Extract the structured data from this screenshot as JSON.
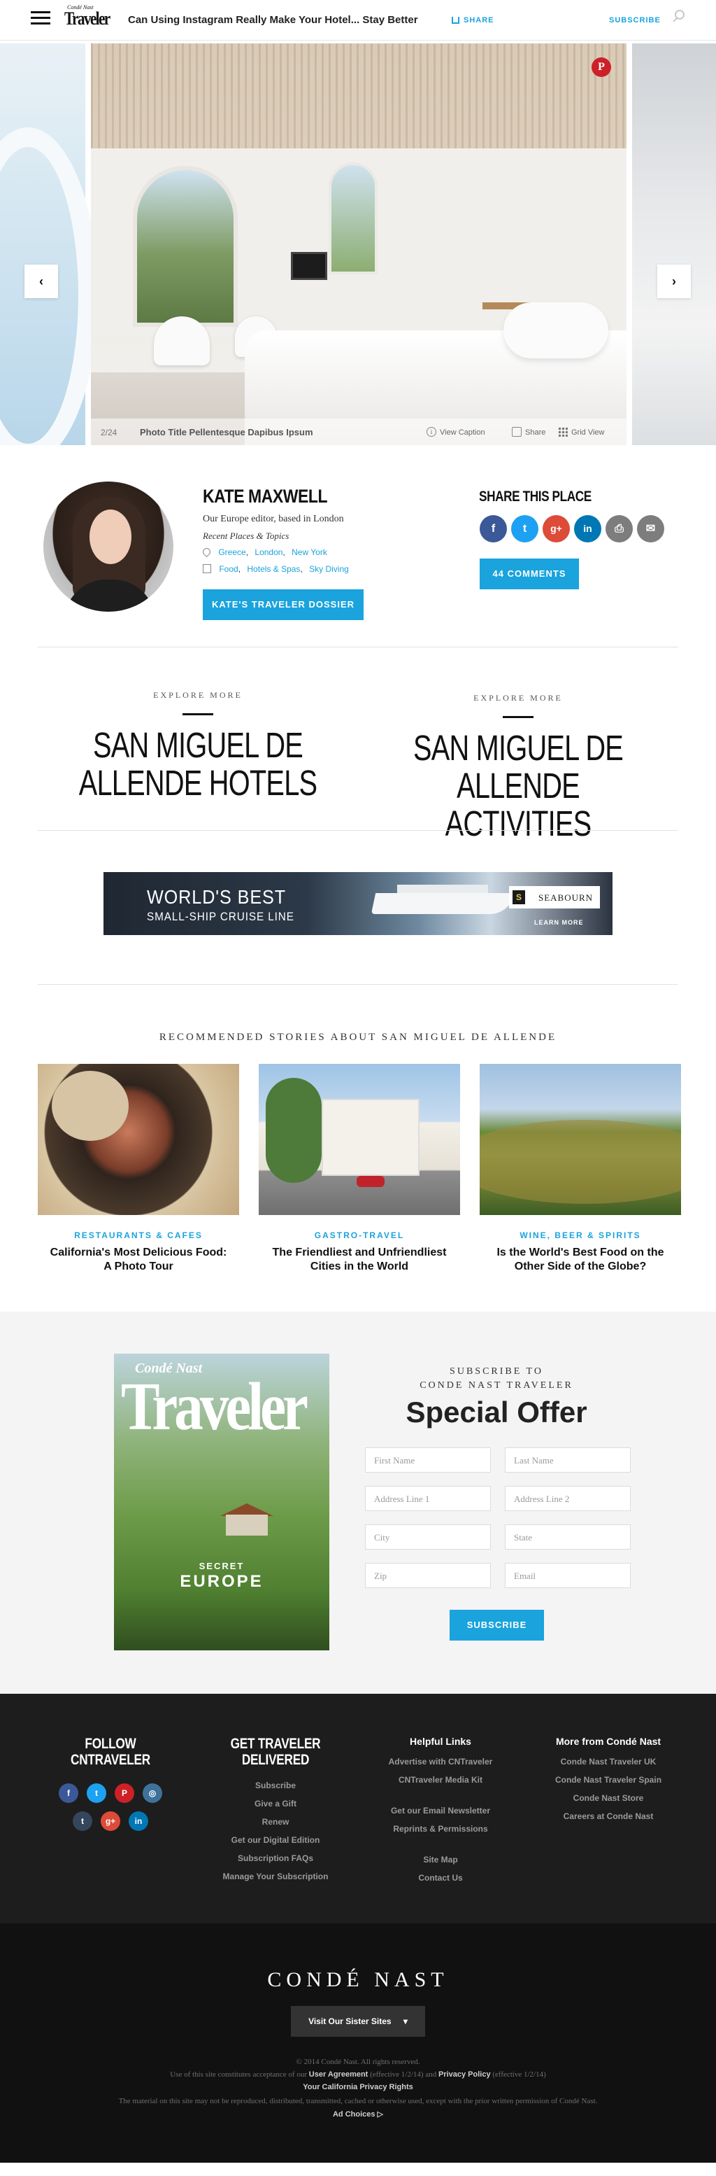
{
  "header": {
    "brand_small": "Condé Nast",
    "brand_big": "Traveler",
    "headline": "Can Using Instagram Really Make Your Hotel... Stay Better",
    "share_label": "SHARE",
    "subscribe_label": "SUBSCRIBE",
    "search_icon": "search-icon",
    "menu_icon": "hamburger-icon"
  },
  "carousel": {
    "counter": "2/24",
    "caption_title": "Photo Title Pellentesque Dapibus Ipsum",
    "view_caption": "View Caption",
    "share": "Share",
    "grid_view": "Grid View",
    "prev_arrow": "‹",
    "next_arrow": "›",
    "pin_label": "P"
  },
  "author": {
    "name": "KATE MAXWELL",
    "role": "Our Europe editor, based in London",
    "recent": "Recent Places & Topics",
    "places": [
      "Greece",
      "London",
      "New York"
    ],
    "topics": [
      "Food",
      "Hotels & Spas",
      "Sky Diving"
    ],
    "dossier_button": "KATE'S TRAVELER DOSSIER",
    "share_title": "SHARE THIS PLACE",
    "social": [
      {
        "label": "f",
        "icon": "facebook-icon",
        "color": "#3b5998"
      },
      {
        "label": "t",
        "icon": "twitter-icon",
        "color": "#1da1f2"
      },
      {
        "label": "g+",
        "icon": "google-plus-icon",
        "color": "#dd4b39"
      },
      {
        "label": "in",
        "icon": "linkedin-icon",
        "color": "#0077b5"
      },
      {
        "label": "⎙",
        "icon": "print-icon",
        "color": "#7d7d7d"
      },
      {
        "label": "✉",
        "icon": "email-icon",
        "color": "#7d7d7d"
      }
    ],
    "comments_button": "44 COMMENTS"
  },
  "explore": [
    {
      "kicker": "EXPLORE MORE",
      "title_line1": "SAN MIGUEL DE",
      "title_line2": "ALLENDE HOTELS"
    },
    {
      "kicker": "EXPLORE MORE",
      "title_line1": "SAN MIGUEL DE",
      "title_line2": "ALLENDE ACTIVITIES"
    }
  ],
  "ad": {
    "line1": "WORLD'S BEST",
    "line2": "SMALL-SHIP CRUISE LINE",
    "brand": "SEABOURN",
    "cta": "LEARN MORE"
  },
  "recommended": {
    "heading": "RECOMMENDED STORIES ABOUT SAN MIGUEL DE ALLENDE",
    "cards": [
      {
        "category": "RESTAURANTS & CAFES",
        "title": "California's Most Delicious Food: A Photo Tour"
      },
      {
        "category": "GASTRO-TRAVEL",
        "title": "The Friendliest and Unfriendliest Cities in the World"
      },
      {
        "category": "WINE, BEER & SPIRITS",
        "title": "Is the World's Best Food on the Other Side of the Globe?"
      }
    ]
  },
  "subscribe": {
    "cover_brand_small": "Condé Nast",
    "cover_brand_big": "Traveler",
    "cover_secret": "SECRET",
    "cover_europe": "EUROPE",
    "kicker1": "SUBSCRIBE TO",
    "kicker2": "CONDE NAST TRAVELER",
    "title": "Special Offer",
    "fields": {
      "first_name": "First Name",
      "last_name": "Last Name",
      "address1": "Address Line 1",
      "address2": "Address Line 2",
      "city": "City",
      "state": "State",
      "zip": "Zip",
      "email": "Email"
    },
    "button": "SUBSCRIBE"
  },
  "footer": {
    "follow_title_1": "FOLLOW",
    "follow_title_2": "CNTRAVELER",
    "follow_icons": [
      {
        "label": "f",
        "icon": "facebook-icon",
        "color": "#3b5998"
      },
      {
        "label": "t",
        "icon": "twitter-icon",
        "color": "#1da1f2"
      },
      {
        "label": "P",
        "icon": "pinterest-icon",
        "color": "#cc2127"
      },
      {
        "label": "◎",
        "icon": "instagram-icon",
        "color": "#3f729b"
      },
      {
        "label": "t",
        "icon": "tumblr-icon",
        "color": "#35465c"
      },
      {
        "label": "g+",
        "icon": "google-plus-icon",
        "color": "#dd4b39"
      },
      {
        "label": "in",
        "icon": "linkedin-icon",
        "color": "#0077b5"
      }
    ],
    "delivered_title_1": "GET TRAVELER",
    "delivered_title_2": "DELIVERED",
    "delivered_links": [
      "Subscribe",
      "Give a Gift",
      "Renew",
      "Get our Digital Edition",
      "Subscription FAQs",
      "Manage Your Subscription"
    ],
    "helpful_title": "Helpful Links",
    "helpful_links_a": [
      "Advertise with CNTraveler",
      "CNTraveler Media Kit"
    ],
    "helpful_links_b": [
      "Get our Email Newsletter",
      "Reprints & Permissions"
    ],
    "helpful_links_c": [
      "Site Map",
      "Contact Us"
    ],
    "more_title": "More from Condé Nast",
    "more_links": [
      "Conde Nast Traveler UK",
      "Conde Nast Traveler Spain",
      "Conde Nast Store",
      "Careers at Conde Nast"
    ]
  },
  "bottom": {
    "brand": "CONDÉ NAST",
    "sister_button": "Visit Our Sister Sites",
    "copyright": "© 2014 Condé Nast. All rights reserved.",
    "use_prefix": "Use of this site constitutes acceptance of our",
    "user_agreement": "User Agreement",
    "ua_date": "(effective 1/2/14) and",
    "privacy_policy": "Privacy Policy",
    "pp_date": "(effective 1/2/14)",
    "california": "Your California Privacy Rights",
    "material": "The material on this site may not be reproduced, distributed, transmitted, cached or otherwise used, except with the prior written permission of Condé Nast.",
    "ad_choices": "Ad Choices ▷"
  }
}
